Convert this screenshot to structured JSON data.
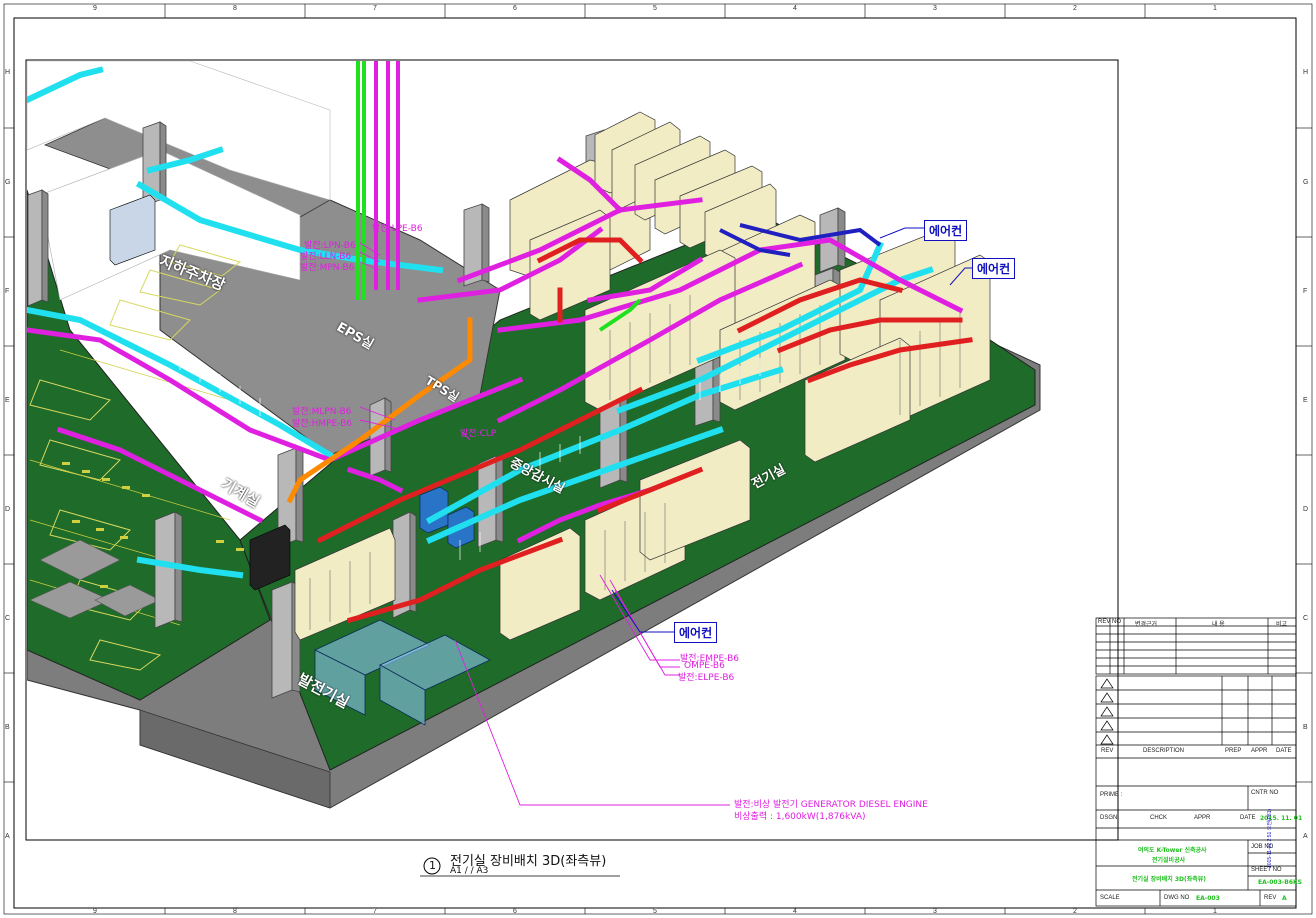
{
  "border": {
    "columns": [
      "9",
      "8",
      "7",
      "6",
      "5",
      "4",
      "3",
      "2",
      "1"
    ],
    "rows": [
      "H",
      "G",
      "F",
      "E",
      "D",
      "C",
      "B",
      "A"
    ]
  },
  "callouts": {
    "aircon_1": "에어컨",
    "aircon_2": "에어컨",
    "aircon_3": "에어컨"
  },
  "labels": {
    "lpn": "발전:LPN-B6",
    "lpe": "발전:LPE-B6",
    "lln": "발전:LLN-B6",
    "mpn": "발전:MPN-B6",
    "mlpn": "발전:MLPN-B6",
    "hmpe": "발전:HMPE-B6",
    "clp": "발전:CLP",
    "empe": "발전:EMPE-B6",
    "ompe": "OMPE-B6",
    "elpe": "발전:ELPE-B6",
    "generator_line1": "발전:비상 발전기 GENERATOR DIESEL ENGINE",
    "generator_line2": "비상출력 : 1,600kW(1,876kVA)"
  },
  "rooms": {
    "parking": "지하주차장",
    "eps": "EPS실",
    "tps": "TPS실",
    "machine": "기계실",
    "electric": "전기실",
    "generator": "발전기실",
    "central": "중앙감시실"
  },
  "drawing_title": {
    "number": "1",
    "title": "전기실 장비배치 3D(좌측뷰)",
    "scale": "A1 /   / A3"
  },
  "revision_table": {
    "headers": [
      "REV",
      "NO",
      "변경근거",
      "내  용",
      "비고"
    ]
  },
  "title_block": {
    "rev": "REV",
    "description": "DESCRIPTION",
    "prep": "PREP",
    "appr": "APPR",
    "date": "DATE",
    "prime": "PRIME :",
    "cntr_no": "CNTR NO",
    "dsgn": "DSGN",
    "chck": "CHCK",
    "appr2": "APPR",
    "date2": "DATE",
    "date_value": "2015. 11. 01",
    "project_line1": "여의도 K-Tower 신축공사",
    "project_line2": "전기설비공사",
    "job_no": "JOB NO",
    "sheet_no": "SHEET NO",
    "sheet_no_value": "EA-003-B6KS",
    "sheet_title": "전기실 장비배치 3D(좌측뷰)",
    "scale": "SCALE",
    "dwg_no": "DWG NO",
    "dwg_no_value": "EA-003",
    "rev2": "REV",
    "rev_value": "A",
    "side_stamp": "2015-11-02 2:51 오전(P81)"
  },
  "colors": {
    "floor_green": "#1e6b2a",
    "slab_gray": "#8a8a8a",
    "cyan_tray": "#20e0f0",
    "magenta_tray": "#e020e0",
    "red_duct": "#e02020",
    "orange_tray": "#ff8a00",
    "callout_blue": "#1010c0"
  }
}
